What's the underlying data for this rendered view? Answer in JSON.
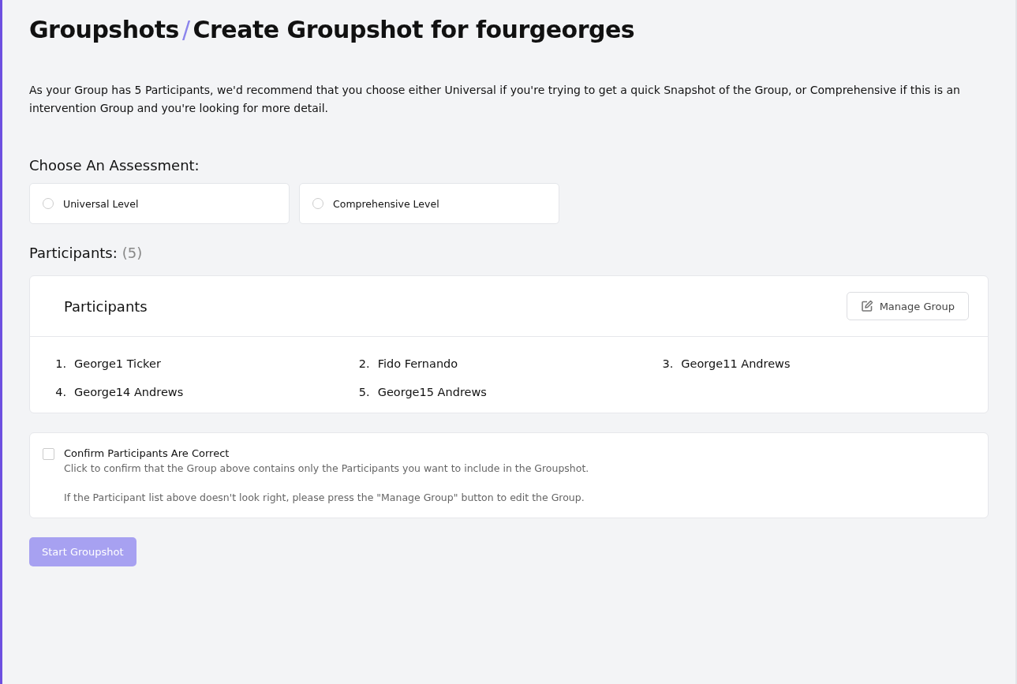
{
  "breadcrumb": {
    "parent": "Groupshots",
    "separator": "/",
    "current": "Create Groupshot for fourgeorges"
  },
  "intro": "As your Group has 5 Participants, we'd recommend that you choose either Universal if you're trying to get a quick Snapshot of the Group, or Comprehensive if this is an intervention Group and you're looking for more detail.",
  "assessment": {
    "heading": "Choose An Assessment:",
    "options": [
      {
        "label": "Universal Level",
        "selected": false
      },
      {
        "label": "Comprehensive Level",
        "selected": false
      }
    ]
  },
  "participants_heading": {
    "label": "Participants:",
    "count": "(5)"
  },
  "participants_card": {
    "title": "Participants",
    "manage_button": "Manage Group",
    "items": [
      {
        "number": "1.",
        "name": "George1 Ticker"
      },
      {
        "number": "2.",
        "name": "Fido Fernando"
      },
      {
        "number": "3.",
        "name": "George11 Andrews"
      },
      {
        "number": "4.",
        "name": "George14 Andrews"
      },
      {
        "number": "5.",
        "name": "George15 Andrews"
      }
    ]
  },
  "confirm": {
    "label": "Confirm Participants Are Correct",
    "checked": false,
    "description": "Click to confirm that the Group above contains only the Participants you want to include in the Groupshot.",
    "hint": "If the Participant list above doesn't look right, please press the \"Manage Group\" button to edit the Group."
  },
  "start_button": {
    "label": "Start Groupshot",
    "disabled": true
  }
}
